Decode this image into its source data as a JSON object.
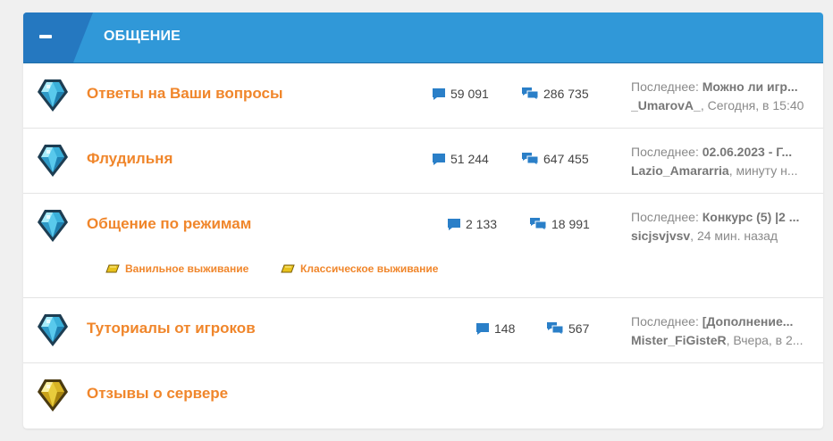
{
  "category": {
    "title": "ОБЩЕНИЕ",
    "toggle_icon": "minus-icon"
  },
  "colors": {
    "header": "#3098d8",
    "header_tab": "#2578c0",
    "title": "#f0862b",
    "icon": "#2a7fc8"
  },
  "forums": [
    {
      "title": "Ответы на Ваши вопросы",
      "icon": "diamond-gem-icon",
      "threads": "59 091",
      "messages": "286 735",
      "last_label": "Последнее:",
      "last_thread": "Можно ли игр...",
      "last_user": "_UmarovA_",
      "last_time": ", Сегодня, в 15:40"
    },
    {
      "title": "Флудильня",
      "icon": "diamond-gem-icon",
      "threads": "51 244",
      "messages": "647 455",
      "last_label": "Последнее:",
      "last_thread": "02.06.2023 - Г...",
      "last_user": "Lazio_Amararria",
      "last_time": ", минуту н..."
    },
    {
      "title": "Общение по режимам",
      "icon": "diamond-gem-icon",
      "threads": "2 133",
      "messages": "18 991",
      "last_label": "Последнее:",
      "last_thread": "Конкурс (5) |2 ...",
      "last_user": "sicjsvjvsv",
      "last_time": ", 24 мин. назад",
      "subforums": [
        "Ванильное выживание",
        "Классическое выживание"
      ]
    },
    {
      "title": "Туториалы от игроков",
      "icon": "diamond-gem-icon",
      "threads": "148",
      "messages": "567",
      "last_label": "Последнее:",
      "last_thread": "[Дополнение...",
      "last_user": "Mister_FiGisteR",
      "last_time": ", Вчера, в 2..."
    },
    {
      "title": "Отзывы о сервере",
      "icon": "gold-gem-icon"
    }
  ]
}
